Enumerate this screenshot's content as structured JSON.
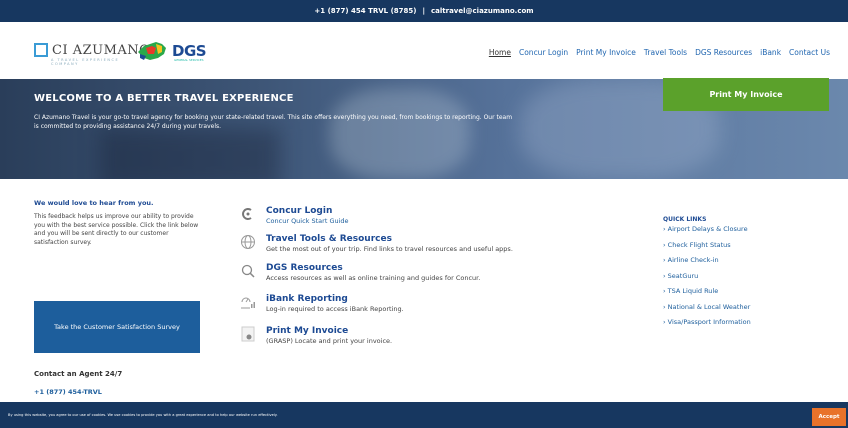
{
  "topbar": {
    "phone": "+1 (877) 454 TRVL (8785)",
    "separator": "|",
    "email": "caltravel@ciazumano.com"
  },
  "logo": {
    "ci_name": "CI AZUMANO",
    "ci_sub": "A TRAVEL EXPERIENCE COMPANY",
    "dgs_name": "DGS",
    "dgs_sub": "GENERAL SERVICES"
  },
  "nav": {
    "items": [
      "Home",
      "Concur Login",
      "Print My Invoice",
      "Travel Tools",
      "DGS Resources",
      "iBank",
      "Contact Us"
    ]
  },
  "hero": {
    "title": "WELCOME TO A BETTER TRAVEL EXPERIENCE",
    "body": "CI Azumano Travel is your go-to travel agency for booking your state-related travel. This site offers everything you need, from bookings to reporting. Our team is committed to providing assistance 24/7 during your travels.",
    "button": "Print My Invoice"
  },
  "feedback": {
    "heading": "We would love to hear from you.",
    "body": "This feedback helps us improve our ability to provide you with the best service possible. Click the link below and you will be sent directly to our customer satisfaction survey.",
    "button": "Take the Customer Satisfaction Survey",
    "contact_title": "Contact an Agent 24/7",
    "contact_phone": "+1 (877) 454-TRVL"
  },
  "resources": [
    {
      "title": "Concur Login",
      "desc": "Concur Quick Start Guide"
    },
    {
      "title": "Travel Tools & Resources",
      "desc": "Get the most out of your trip. Find links to travel resources and useful apps."
    },
    {
      "title": "DGS Resources",
      "desc": "Access resources as well as online training and guides for Concur."
    },
    {
      "title": "iBank Reporting",
      "desc": "Log-in required to access iBank Reporting."
    },
    {
      "title": "Print My Invoice",
      "desc": "(GRASP) Locate and print your invoice."
    }
  ],
  "quick_links": {
    "heading": "QUICK LINKS",
    "items": [
      "Airport Delays & Closure",
      "Check Flight Status",
      "Airline Check-in",
      "SeatGuru",
      "TSA Liquid Rule",
      "National & Local Weather",
      "Visa/Passport Information"
    ]
  },
  "cookie": {
    "text": "By using this website, you agree to our use of cookies. We use cookies to provide you with a great experience and to help our website run effectively.",
    "button": "Accept"
  },
  "colors": {
    "navy": "#173760",
    "link": "#1d5e9c",
    "green": "#5ba12b",
    "orange": "#e8722a"
  }
}
